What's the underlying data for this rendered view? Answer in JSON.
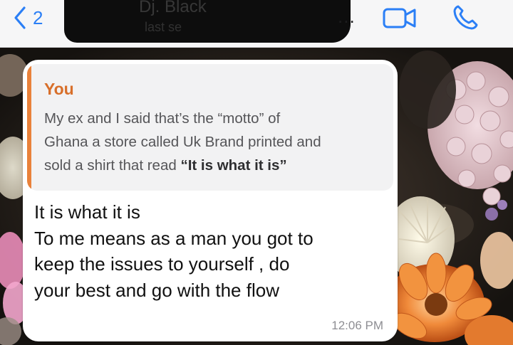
{
  "header": {
    "back_count": "2",
    "contact_name": "Dj. Black",
    "contact_subtitle": "last se",
    "more_label": "..."
  },
  "icons": {
    "back": "chevron-left-icon",
    "video": "video-camera-icon",
    "call": "phone-icon"
  },
  "message": {
    "reply": {
      "author": "You",
      "text_lines": [
        "My ex and I said that’s the “motto” of",
        "Ghana a store called Uk Brand printed and",
        "sold a shirt that read "
      ],
      "bold_text": "“It is what it is”"
    },
    "body_lines": [
      "It is what it is",
      "To me means as a man you got to",
      "keep the issues to yourself , do",
      "your best and go with the flow"
    ],
    "time": "12:06 PM"
  },
  "colors": {
    "accent": "#2b7ff6",
    "reply_author": "#d86f2a",
    "reply_bar": "#e9813a",
    "bubble": "#ffffff"
  }
}
